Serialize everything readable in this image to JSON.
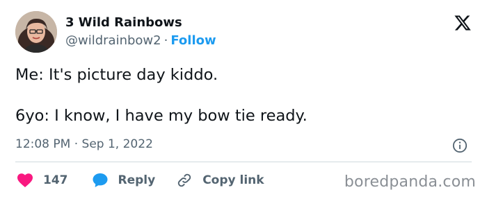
{
  "author": {
    "name": "3 Wild Rainbows",
    "handle": "@wildrainbow2",
    "separator": "·",
    "follow_label": "Follow"
  },
  "tweet": {
    "lines": [
      "Me: It's picture day kiddo.",
      "6yo: I know, I have my bow tie ready."
    ],
    "time": "12:08 PM",
    "meta_separator": "·",
    "date": "Sep 1, 2022"
  },
  "actions": {
    "like_count": "147",
    "reply_label": "Reply",
    "copy_link_label": "Copy link"
  },
  "icons": {
    "like": "heart-icon",
    "reply": "speech-bubble-icon",
    "copy_link": "link-icon",
    "info": "info-icon",
    "brand": "x-logo-icon"
  },
  "colors": {
    "like": "#f91880",
    "reply": "#1d9bf0",
    "follow": "#1d9bf0",
    "text": "#0f1419",
    "secondary": "#536471"
  },
  "watermark": "boredpanda.com"
}
